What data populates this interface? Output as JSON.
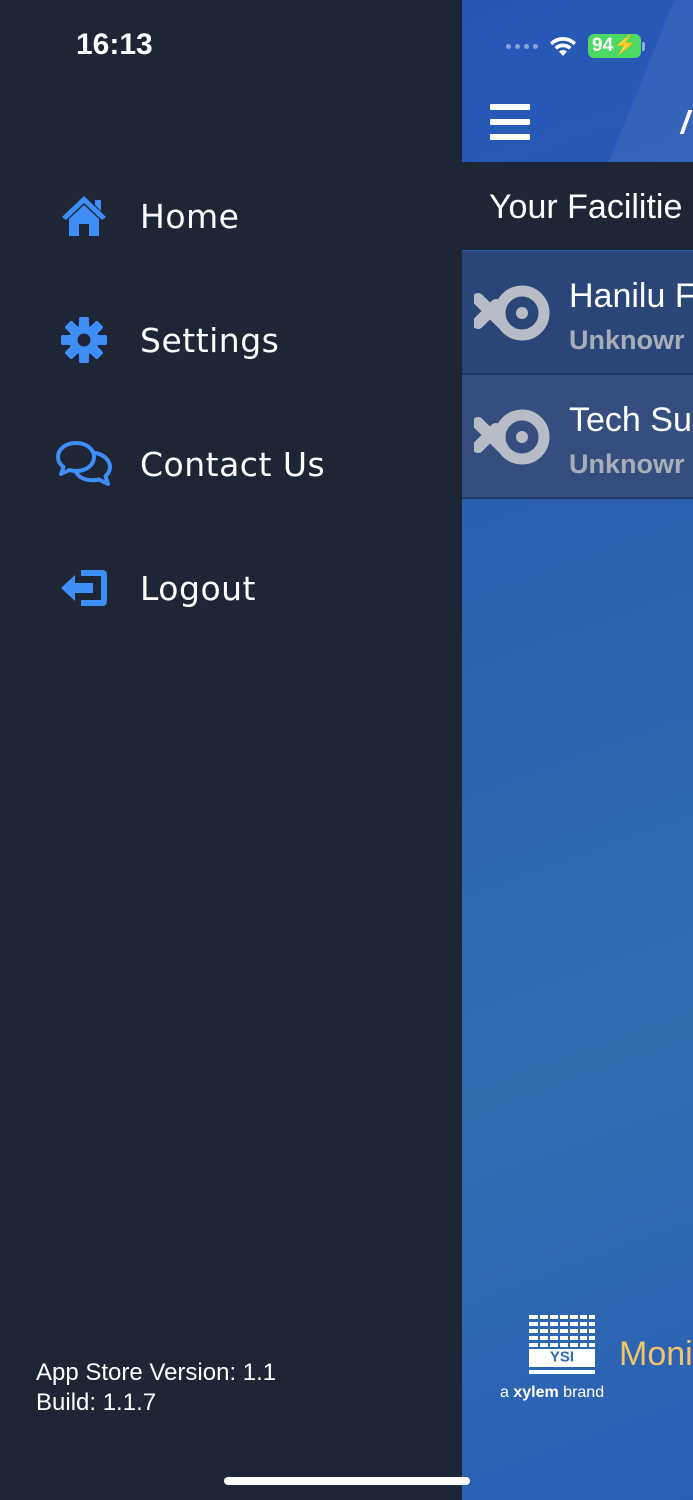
{
  "status_bar": {
    "time": "16:13",
    "battery": "94"
  },
  "drawer": {
    "menu": [
      {
        "label": "Home",
        "icon": "home-icon"
      },
      {
        "label": "Settings",
        "icon": "gear-icon"
      },
      {
        "label": "Contact Us",
        "icon": "chat-bubbles-icon"
      },
      {
        "label": "Logout",
        "icon": "logout-icon"
      }
    ],
    "version_label": "App Store Version: 1.1",
    "build_label": "Build: 1.1.7"
  },
  "main": {
    "section_title": "Your Facilitie",
    "facilities": [
      {
        "name": "Hanilu F",
        "status": "Unknowr"
      },
      {
        "name": "Tech Su",
        "status": "Unknowr"
      }
    ],
    "brand_tagline_prefix": "a ",
    "brand_tagline_bold": "xylem",
    "brand_tagline_suffix": " brand",
    "brand_logo_text": "YSI",
    "footer_label": "Moni"
  },
  "colors": {
    "drawer_bg": "#1e2535",
    "accent_icon": "#3f8ef7",
    "main_gradient": "#2c64ad",
    "footer_label": "#f2c46b"
  }
}
